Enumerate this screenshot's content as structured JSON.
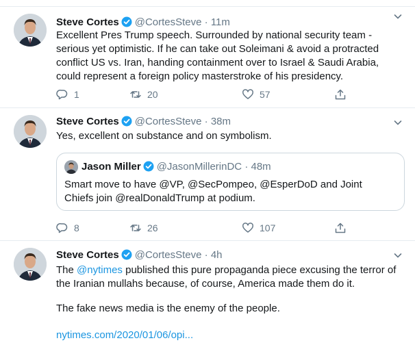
{
  "tweets": [
    {
      "name": "Steve Cortes",
      "handle": "@CortesSteve",
      "separator": "·",
      "time": "11m",
      "text": "Excellent Pres Trump speech. Surrounded by national security team - serious yet optimistic. If he can take out Soleimani & avoid a protracted conflict US vs. Iran, handing containment over to Israel & Saudi Arabia, could represent a foreign policy masterstroke of his presidency.",
      "replies": "1",
      "retweets": "20",
      "likes": "57"
    },
    {
      "name": "Steve Cortes",
      "handle": "@CortesSteve",
      "separator": "·",
      "time": "38m",
      "text": "Yes, excellent on substance and on symbolism.",
      "quote": {
        "name": "Jason Miller",
        "handle": "@JasonMillerinDC",
        "separator": "·",
        "time": "48m",
        "text": "Smart move to have @VP, @SecPompeo, @EsperDoD and Joint Chiefs join @realDonaldTrump at podium."
      },
      "replies": "8",
      "retweets": "26",
      "likes": "107"
    },
    {
      "name": "Steve Cortes",
      "handle": "@CortesSteve",
      "separator": "·",
      "time": "4h",
      "text_prefix": "The ",
      "mention": "@nytimes",
      "text_suffix": " published this pure propaganda piece excusing the terror of the Iranian mullahs because, of course, America made them do it.",
      "text2": "The fake news media is the enemy of the people.",
      "url": "nytimes.com/2020/01/06/opi..."
    }
  ],
  "colors": {
    "text": "#14171a",
    "secondary": "#657786",
    "link": "#1b95e0",
    "verified": "#1da1f2",
    "border": "#e6ecf0"
  },
  "icons": [
    "reply-icon",
    "retweet-icon",
    "like-icon",
    "share-icon",
    "verified-badge-icon",
    "chevron-down-icon"
  ]
}
